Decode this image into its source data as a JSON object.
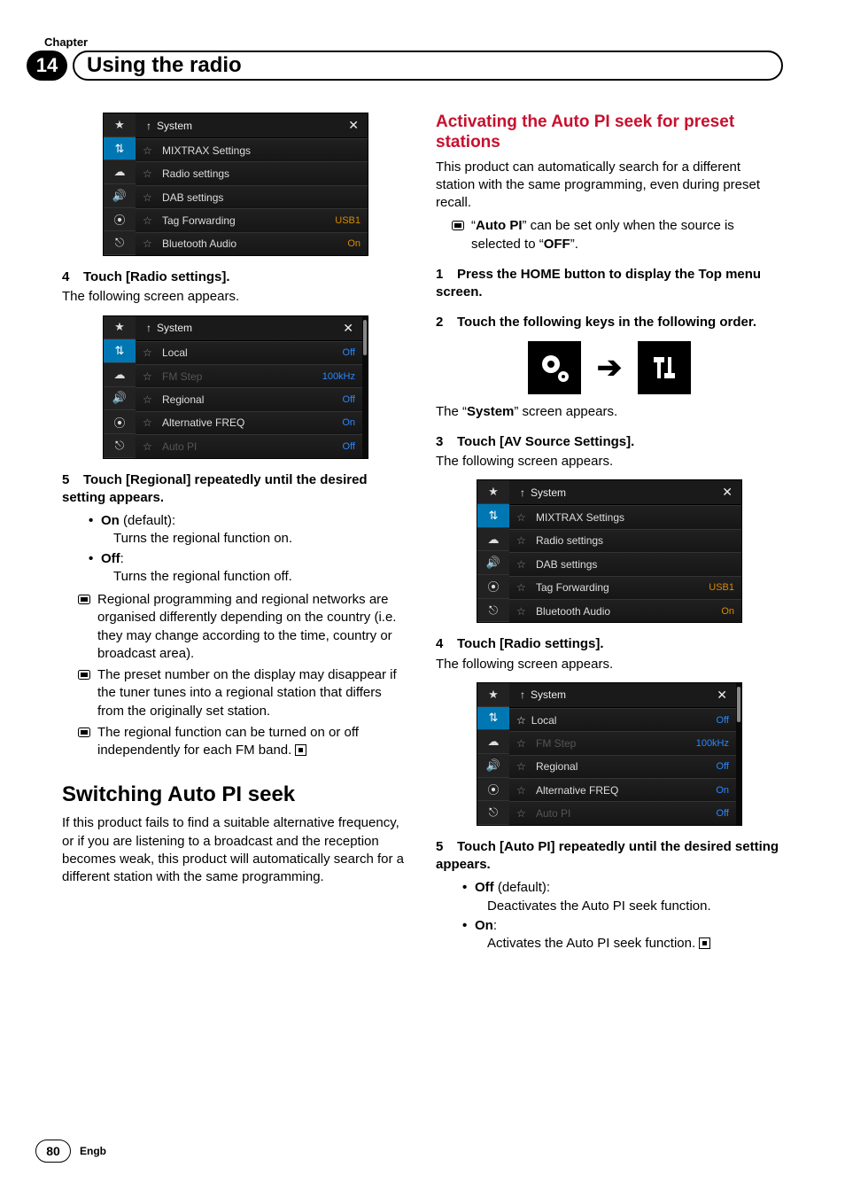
{
  "chapter_label": "Chapter",
  "chapter_number": "14",
  "chapter_title": "Using the radio",
  "page_number": "80",
  "lang": "Engb",
  "left": {
    "ss1": {
      "header": "System",
      "rows": [
        {
          "label": "MIXTRAX Settings",
          "value": ""
        },
        {
          "label": "Radio settings",
          "value": ""
        },
        {
          "label": "DAB settings",
          "value": ""
        },
        {
          "label": "Tag Forwarding",
          "value": "USB1"
        },
        {
          "label": "Bluetooth Audio",
          "value": "On"
        }
      ]
    },
    "step4_num": "4",
    "step4_title": "Touch [Radio settings].",
    "step4_body": "The following screen appears.",
    "ss2": {
      "header": "System",
      "rows": [
        {
          "label": "Local",
          "value": "Off"
        },
        {
          "label": "FM Step",
          "value": "100kHz",
          "dim": true
        },
        {
          "label": "Regional",
          "value": "Off"
        },
        {
          "label": "Alternative FREQ",
          "value": "On"
        },
        {
          "label": "Auto PI",
          "value": "Off",
          "dim": true
        }
      ]
    },
    "step5_num": "5",
    "step5_title": "Touch [Regional] repeatedly until the desired setting appears.",
    "bullet_on_label": "On",
    "bullet_on_suffix": " (default):",
    "bullet_on_body": "Turns the regional function on.",
    "bullet_off_label": "Off",
    "bullet_off_suffix": ":",
    "bullet_off_body": "Turns the regional function off.",
    "note1": "Regional programming and regional networks are organised differently depending on the country (i.e. they may change according to the time, country or broadcast area).",
    "note2": "The preset number on the display may disappear if the tuner tunes into a regional station that differs from the originally set station.",
    "note3": "The regional function can be turned on or off independently for each FM band.",
    "h2": "Switching Auto PI seek",
    "h2_body": "If this product fails to find a suitable alternative frequency, or if you are listening to a broadcast and the reception becomes weak, this product will automatically search for a different station with the same programming."
  },
  "right": {
    "h3": "Activating the Auto PI seek for preset stations",
    "intro": "This product can automatically search for a different station with the same programming, even during preset recall.",
    "note_pre": "“",
    "note_autopi": "Auto PI",
    "note_mid": "” can be set only when the source is selected to “",
    "note_off": "OFF",
    "note_post": "”.",
    "step1_num": "1",
    "step1_title": "Press the HOME button to display the Top menu screen.",
    "step2_num": "2",
    "step2_title": "Touch the following keys in the following order.",
    "after_icons_pre": "The “",
    "after_icons_bold": "System",
    "after_icons_post": "” screen appears.",
    "step3_num": "3",
    "step3_title": "Touch [AV Source Settings].",
    "step3_body": "The following screen appears.",
    "ss3": {
      "header": "System",
      "rows": [
        {
          "label": "MIXTRAX Settings",
          "value": ""
        },
        {
          "label": "Radio settings",
          "value": ""
        },
        {
          "label": "DAB settings",
          "value": ""
        },
        {
          "label": "Tag Forwarding",
          "value": "USB1"
        },
        {
          "label": "Bluetooth Audio",
          "value": "On"
        }
      ]
    },
    "step4_num": "4",
    "step4_title": "Touch [Radio settings].",
    "step4_body": "The following screen appears.",
    "ss4": {
      "header": "System",
      "rows": [
        {
          "label": "Local",
          "value": "Off"
        },
        {
          "label": "FM Step",
          "value": "100kHz",
          "dim": true
        },
        {
          "label": "Regional",
          "value": "Off"
        },
        {
          "label": "Alternative FREQ",
          "value": "On"
        },
        {
          "label": "Auto PI",
          "value": "Off",
          "dim": true
        }
      ]
    },
    "step5_num": "5",
    "step5_title": "Touch [Auto PI] repeatedly until the desired setting appears.",
    "bullet_off_label": "Off",
    "bullet_off_suffix": " (default):",
    "bullet_off_body": "Deactivates the Auto PI seek function.",
    "bullet_on_label": "On",
    "bullet_on_suffix": ":",
    "bullet_on_body": "Activates the Auto PI seek function."
  },
  "icons": {
    "sidebar": [
      "★",
      "⇅",
      "☁",
      "🔊",
      "⦿",
      "⎋"
    ],
    "up": "↑",
    "close": "✕",
    "star": "☆",
    "arrow": "➔"
  }
}
